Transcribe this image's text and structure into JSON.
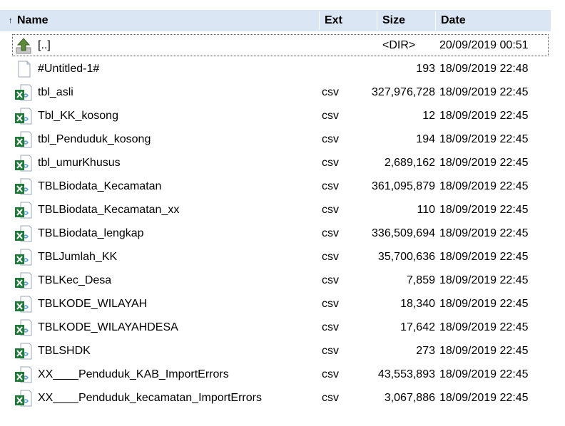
{
  "header": {
    "sort_arrow": "↑",
    "name": "Name",
    "ext": "Ext",
    "size": "Size",
    "date": "Date"
  },
  "parent": {
    "name": "[..]",
    "size": "<DIR>",
    "date": "20/09/2019 00:51"
  },
  "rows": [
    {
      "name": "#Untitled-1#",
      "ext": "",
      "size": "193",
      "date": "18/09/2019 22:48",
      "icon": "blank-file-icon"
    },
    {
      "name": "tbl_asli",
      "ext": "csv",
      "size": "327,976,728",
      "date": "18/09/2019 22:45",
      "icon": "excel-file-icon"
    },
    {
      "name": "Tbl_KK_kosong",
      "ext": "csv",
      "size": "12",
      "date": "18/09/2019 22:45",
      "icon": "excel-file-icon"
    },
    {
      "name": "tbl_Penduduk_kosong",
      "ext": "csv",
      "size": "194",
      "date": "18/09/2019 22:45",
      "icon": "excel-file-icon"
    },
    {
      "name": "tbl_umurKhusus",
      "ext": "csv",
      "size": "2,689,162",
      "date": "18/09/2019 22:45",
      "icon": "excel-file-icon"
    },
    {
      "name": "TBLBiodata_Kecamatan",
      "ext": "csv",
      "size": "361,095,879",
      "date": "18/09/2019 22:45",
      "icon": "excel-file-icon"
    },
    {
      "name": "TBLBiodata_Kecamatan_xx",
      "ext": "csv",
      "size": "110",
      "date": "18/09/2019 22:45",
      "icon": "excel-file-icon"
    },
    {
      "name": "TBLBiodata_lengkap",
      "ext": "csv",
      "size": "336,509,694",
      "date": "18/09/2019 22:45",
      "icon": "excel-file-icon"
    },
    {
      "name": "TBLJumlah_KK",
      "ext": "csv",
      "size": "35,700,636",
      "date": "18/09/2019 22:45",
      "icon": "excel-file-icon"
    },
    {
      "name": "TBLKec_Desa",
      "ext": "csv",
      "size": "7,859",
      "date": "18/09/2019 22:45",
      "icon": "excel-file-icon"
    },
    {
      "name": "TBLKODE_WILAYAH",
      "ext": "csv",
      "size": "18,340",
      "date": "18/09/2019 22:45",
      "icon": "excel-file-icon"
    },
    {
      "name": "TBLKODE_WILAYAHDESA",
      "ext": "csv",
      "size": "17,642",
      "date": "18/09/2019 22:45",
      "icon": "excel-file-icon"
    },
    {
      "name": "TBLSHDK",
      "ext": "csv",
      "size": "273",
      "date": "18/09/2019 22:45",
      "icon": "excel-file-icon"
    },
    {
      "name": "XX____Penduduk_KAB_ImportErrors",
      "ext": "csv",
      "size": "43,553,893",
      "date": "18/09/2019 22:45",
      "icon": "excel-file-icon"
    },
    {
      "name": "XX____Penduduk_kecamatan_ImportErrors",
      "ext": "csv",
      "size": "3,067,886",
      "date": "18/09/2019 22:45",
      "icon": "excel-file-icon"
    }
  ],
  "colors": {
    "header_bg": "#dbe6f5",
    "excel_green": "#1f7a3a",
    "parent_arrow_green": "#5a8a3a"
  }
}
